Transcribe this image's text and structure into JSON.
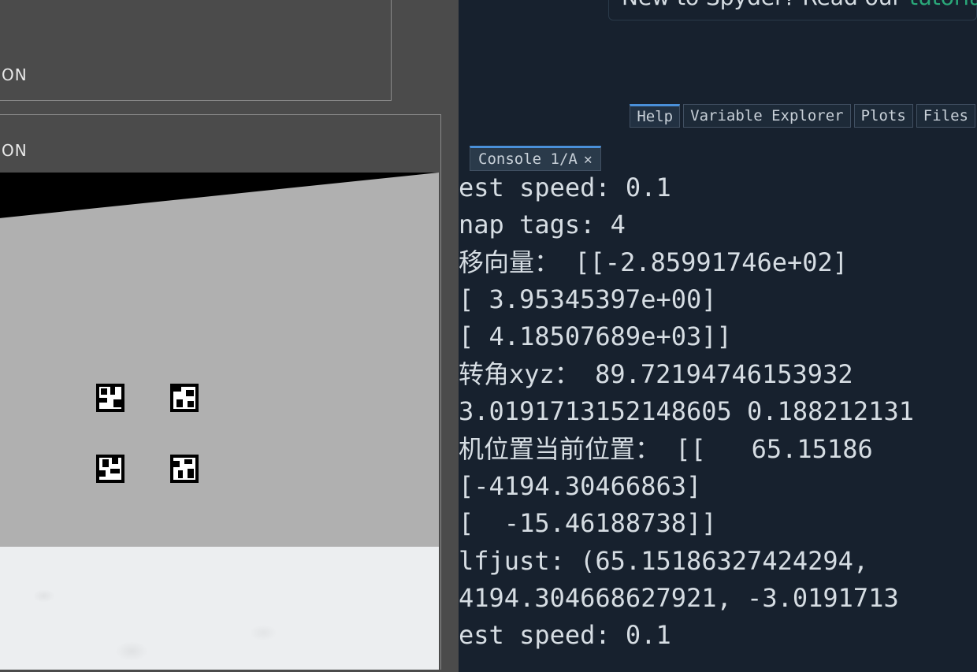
{
  "left": {
    "panel_top_label": "ON",
    "panel_mid_label": "ON"
  },
  "banner": {
    "prefix": "New to Spyder? Read our ",
    "link": "tutoria"
  },
  "panetabs": {
    "help": "Help",
    "variable_explorer": "Variable Explorer",
    "plots": "Plots",
    "files": "Files"
  },
  "console": {
    "tab_label": "Console 1/A",
    "close_glyph": "✕",
    "lines": [
      "est speed: 0.1",
      "nap tags: 4",
      "移向量： [[-2.85991746e+02]",
      "[ 3.95345397e+00]",
      "[ 4.18507689e+03]]",
      "转角xyz： 89.72194746153932 ",
      "3.0191713152148605 0.188212131",
      "机位置当前位置： [[   65.15186",
      "[-4194.30466863]",
      "[  -15.46188738]]",
      "lfjust: (65.15186327424294, ",
      "4194.304668627921, -3.0191713",
      "est speed: 0.1"
    ]
  }
}
